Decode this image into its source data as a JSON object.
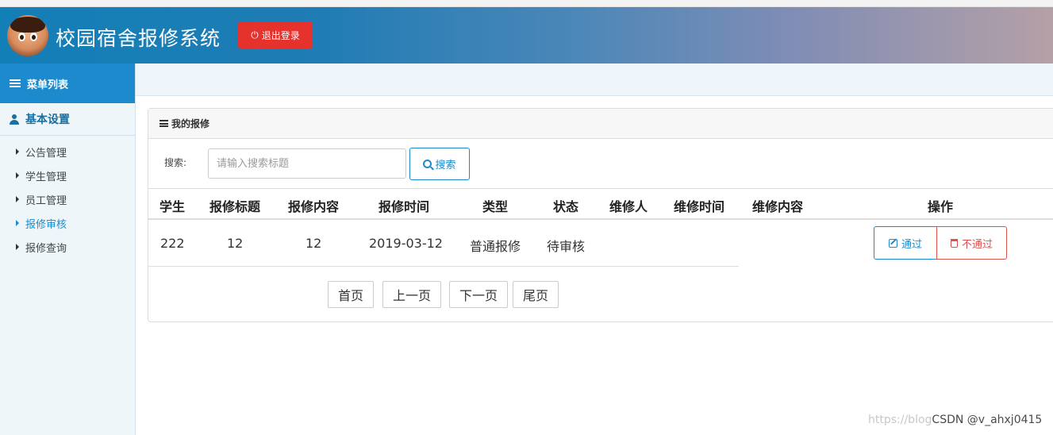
{
  "header": {
    "app_title": "校园宿舍报修系统",
    "logout_label": "退出登录",
    "colors": {
      "logout": "#e5322d",
      "accent": "#1d8acd"
    }
  },
  "sidebar": {
    "menu_title": "菜单列表",
    "section_title": "基本设置",
    "items": [
      {
        "label": "公告管理",
        "active": false
      },
      {
        "label": "学生管理",
        "active": false
      },
      {
        "label": "员工管理",
        "active": false
      },
      {
        "label": "报修审核",
        "active": true
      },
      {
        "label": "报修查询",
        "active": false
      }
    ]
  },
  "panel": {
    "title": "我的报修",
    "search_label": "搜索:",
    "search_placeholder": "请输入搜索标题",
    "search_button": "搜索"
  },
  "table": {
    "headers": [
      "学生",
      "报修标题",
      "报修内容",
      "报修时间",
      "类型",
      "状态",
      "维修人",
      "维修时间",
      "维修内容",
      "操作"
    ],
    "rows": [
      {
        "student": "222",
        "title": "12",
        "content": "12",
        "time": "2019-03-12",
        "type": "普通报修",
        "status": "待审核",
        "repairer": "",
        "repair_time": "",
        "repair_content": ""
      }
    ],
    "actions": {
      "pass": "通过",
      "reject": "不通过"
    }
  },
  "pagination": {
    "first": "首页",
    "prev": "上一页",
    "next": "下一页",
    "last": "尾页"
  },
  "watermark": {
    "faint": "https://blog",
    "strong": "CSDN @v_ahxj0415"
  }
}
